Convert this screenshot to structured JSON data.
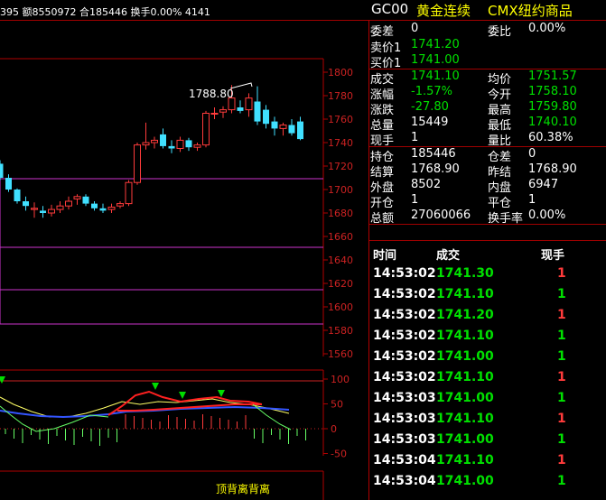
{
  "top_bar": {
    "stats_text": "395 额8550972 合185446 换手0.00% 4141",
    "symbol": "GC00",
    "name": "黄金连续",
    "exchange": "CMX纽约商品"
  },
  "chart": {
    "y_ticks": [
      "1800",
      "1780",
      "1760",
      "1740",
      "1720",
      "1700",
      "1680",
      "1660",
      "1640",
      "1620",
      "1600",
      "1580",
      "1560"
    ],
    "peak_label": "1788.80",
    "indicator_ticks": [
      "100",
      "50",
      "0",
      "-50"
    ],
    "bottom_label": "顶背离背离"
  },
  "chart_data": {
    "type": "candlestick",
    "ylim": [
      1560,
      1810
    ],
    "candles": [
      {
        "o": 1722,
        "h": 1725,
        "l": 1708,
        "c": 1710
      },
      {
        "o": 1710,
        "h": 1713,
        "l": 1698,
        "c": 1700
      },
      {
        "o": 1700,
        "h": 1701,
        "l": 1688,
        "c": 1690
      },
      {
        "o": 1690,
        "h": 1694,
        "l": 1682,
        "c": 1686
      },
      {
        "o": 1683,
        "h": 1689,
        "l": 1676,
        "c": 1684
      },
      {
        "o": 1682,
        "h": 1686,
        "l": 1676,
        "c": 1680
      },
      {
        "o": 1680,
        "h": 1687,
        "l": 1677,
        "c": 1683
      },
      {
        "o": 1683,
        "h": 1690,
        "l": 1680,
        "c": 1686
      },
      {
        "o": 1686,
        "h": 1694,
        "l": 1683,
        "c": 1690
      },
      {
        "o": 1692,
        "h": 1696,
        "l": 1687,
        "c": 1694
      },
      {
        "o": 1694,
        "h": 1696,
        "l": 1686,
        "c": 1688
      },
      {
        "o": 1688,
        "h": 1690,
        "l": 1682,
        "c": 1684
      },
      {
        "o": 1684,
        "h": 1688,
        "l": 1680,
        "c": 1682
      },
      {
        "o": 1683,
        "h": 1688,
        "l": 1680,
        "c": 1685
      },
      {
        "o": 1686,
        "h": 1690,
        "l": 1684,
        "c": 1688
      },
      {
        "o": 1688,
        "h": 1708,
        "l": 1686,
        "c": 1706
      },
      {
        "o": 1706,
        "h": 1740,
        "l": 1704,
        "c": 1738
      },
      {
        "o": 1738,
        "h": 1757,
        "l": 1734,
        "c": 1740
      },
      {
        "o": 1740,
        "h": 1745,
        "l": 1735,
        "c": 1742
      },
      {
        "o": 1747,
        "h": 1752,
        "l": 1735,
        "c": 1737
      },
      {
        "o": 1737,
        "h": 1742,
        "l": 1731,
        "c": 1735
      },
      {
        "o": 1735,
        "h": 1745,
        "l": 1732,
        "c": 1742
      },
      {
        "o": 1742,
        "h": 1744,
        "l": 1733,
        "c": 1736
      },
      {
        "o": 1736,
        "h": 1740,
        "l": 1733,
        "c": 1738
      },
      {
        "o": 1738,
        "h": 1767,
        "l": 1736,
        "c": 1765
      },
      {
        "o": 1765,
        "h": 1770,
        "l": 1760,
        "c": 1765
      },
      {
        "o": 1766,
        "h": 1771,
        "l": 1761,
        "c": 1768
      },
      {
        "o": 1768,
        "h": 1789,
        "l": 1765,
        "c": 1778
      },
      {
        "o": 1770,
        "h": 1776,
        "l": 1765,
        "c": 1767
      },
      {
        "o": 1768,
        "h": 1782,
        "l": 1762,
        "c": 1778
      },
      {
        "o": 1775,
        "h": 1788,
        "l": 1755,
        "c": 1758
      },
      {
        "o": 1768,
        "h": 1772,
        "l": 1752,
        "c": 1756
      },
      {
        "o": 1758,
        "h": 1762,
        "l": 1746,
        "c": 1752
      },
      {
        "o": 1752,
        "h": 1757,
        "l": 1746,
        "c": 1755
      },
      {
        "o": 1755,
        "h": 1760,
        "l": 1746,
        "c": 1748
      },
      {
        "o": 1758,
        "h": 1762,
        "l": 1742,
        "c": 1743
      }
    ]
  },
  "quote": {
    "rows": [
      {
        "l1": "委差",
        "v1": "0",
        "l2": "委比",
        "v2": "0.00%",
        "c1": "white",
        "c2": "white"
      },
      {
        "l1": "卖价1",
        "v1": "1741.20",
        "l2": "",
        "v2": "",
        "c1": "green",
        "c2": "white"
      },
      {
        "l1": "买价1",
        "v1": "1741.00",
        "l2": "",
        "v2": "",
        "c1": "green",
        "c2": "white"
      },
      {
        "l1": "成交",
        "v1": "1741.10",
        "l2": "均价",
        "v2": "1751.57",
        "c1": "green",
        "c2": "green"
      },
      {
        "l1": "涨幅",
        "v1": "-1.57%",
        "l2": "今开",
        "v2": "1758.10",
        "c1": "green",
        "c2": "green"
      },
      {
        "l1": "涨跌",
        "v1": "-27.80",
        "l2": "最高",
        "v2": "1759.80",
        "c1": "green",
        "c2": "green"
      },
      {
        "l1": "总量",
        "v1": "15449",
        "l2": "最低",
        "v2": "1740.10",
        "c1": "white",
        "c2": "green"
      },
      {
        "l1": "现手",
        "v1": "1",
        "l2": "量比",
        "v2": "60.38%",
        "c1": "white",
        "c2": "white"
      },
      {
        "l1": "持仓",
        "v1": "185446",
        "l2": "仓差",
        "v2": "0",
        "c1": "white",
        "c2": "white"
      },
      {
        "l1": "结算",
        "v1": "1768.90",
        "l2": "昨结",
        "v2": "1768.90",
        "c1": "white",
        "c2": "white"
      },
      {
        "l1": "外盘",
        "v1": "8502",
        "l2": "内盘",
        "v2": "6947",
        "c1": "white",
        "c2": "white"
      },
      {
        "l1": "开仓",
        "v1": "1",
        "l2": "平仓",
        "v2": "1",
        "c1": "white",
        "c2": "white"
      },
      {
        "l1": "总额",
        "v1": "27060066",
        "l2": "换手率",
        "v2": "0.00%",
        "c1": "white",
        "c2": "white"
      }
    ]
  },
  "trades": {
    "headers": {
      "time": "时间",
      "price": "成交",
      "qty": "现手"
    },
    "rows": [
      {
        "time": "14:53:02",
        "price": "1741.30",
        "qty": "1",
        "qc": "red"
      },
      {
        "time": "14:53:02",
        "price": "1741.10",
        "qty": "1",
        "qc": "green"
      },
      {
        "time": "14:53:02",
        "price": "1741.20",
        "qty": "1",
        "qc": "red"
      },
      {
        "time": "14:53:02",
        "price": "1741.10",
        "qty": "1",
        "qc": "green"
      },
      {
        "time": "14:53:02",
        "price": "1741.00",
        "qty": "1",
        "qc": "green"
      },
      {
        "time": "14:53:02",
        "price": "1741.10",
        "qty": "1",
        "qc": "red"
      },
      {
        "time": "14:53:03",
        "price": "1741.00",
        "qty": "1",
        "qc": "green"
      },
      {
        "time": "14:53:03",
        "price": "1741.10",
        "qty": "1",
        "qc": "red"
      },
      {
        "time": "14:53:03",
        "price": "1741.00",
        "qty": "1",
        "qc": "green"
      },
      {
        "time": "14:53:04",
        "price": "1741.10",
        "qty": "1",
        "qc": "red"
      },
      {
        "time": "14:53:04",
        "price": "1741.00",
        "qty": "1",
        "qc": "green"
      }
    ]
  }
}
